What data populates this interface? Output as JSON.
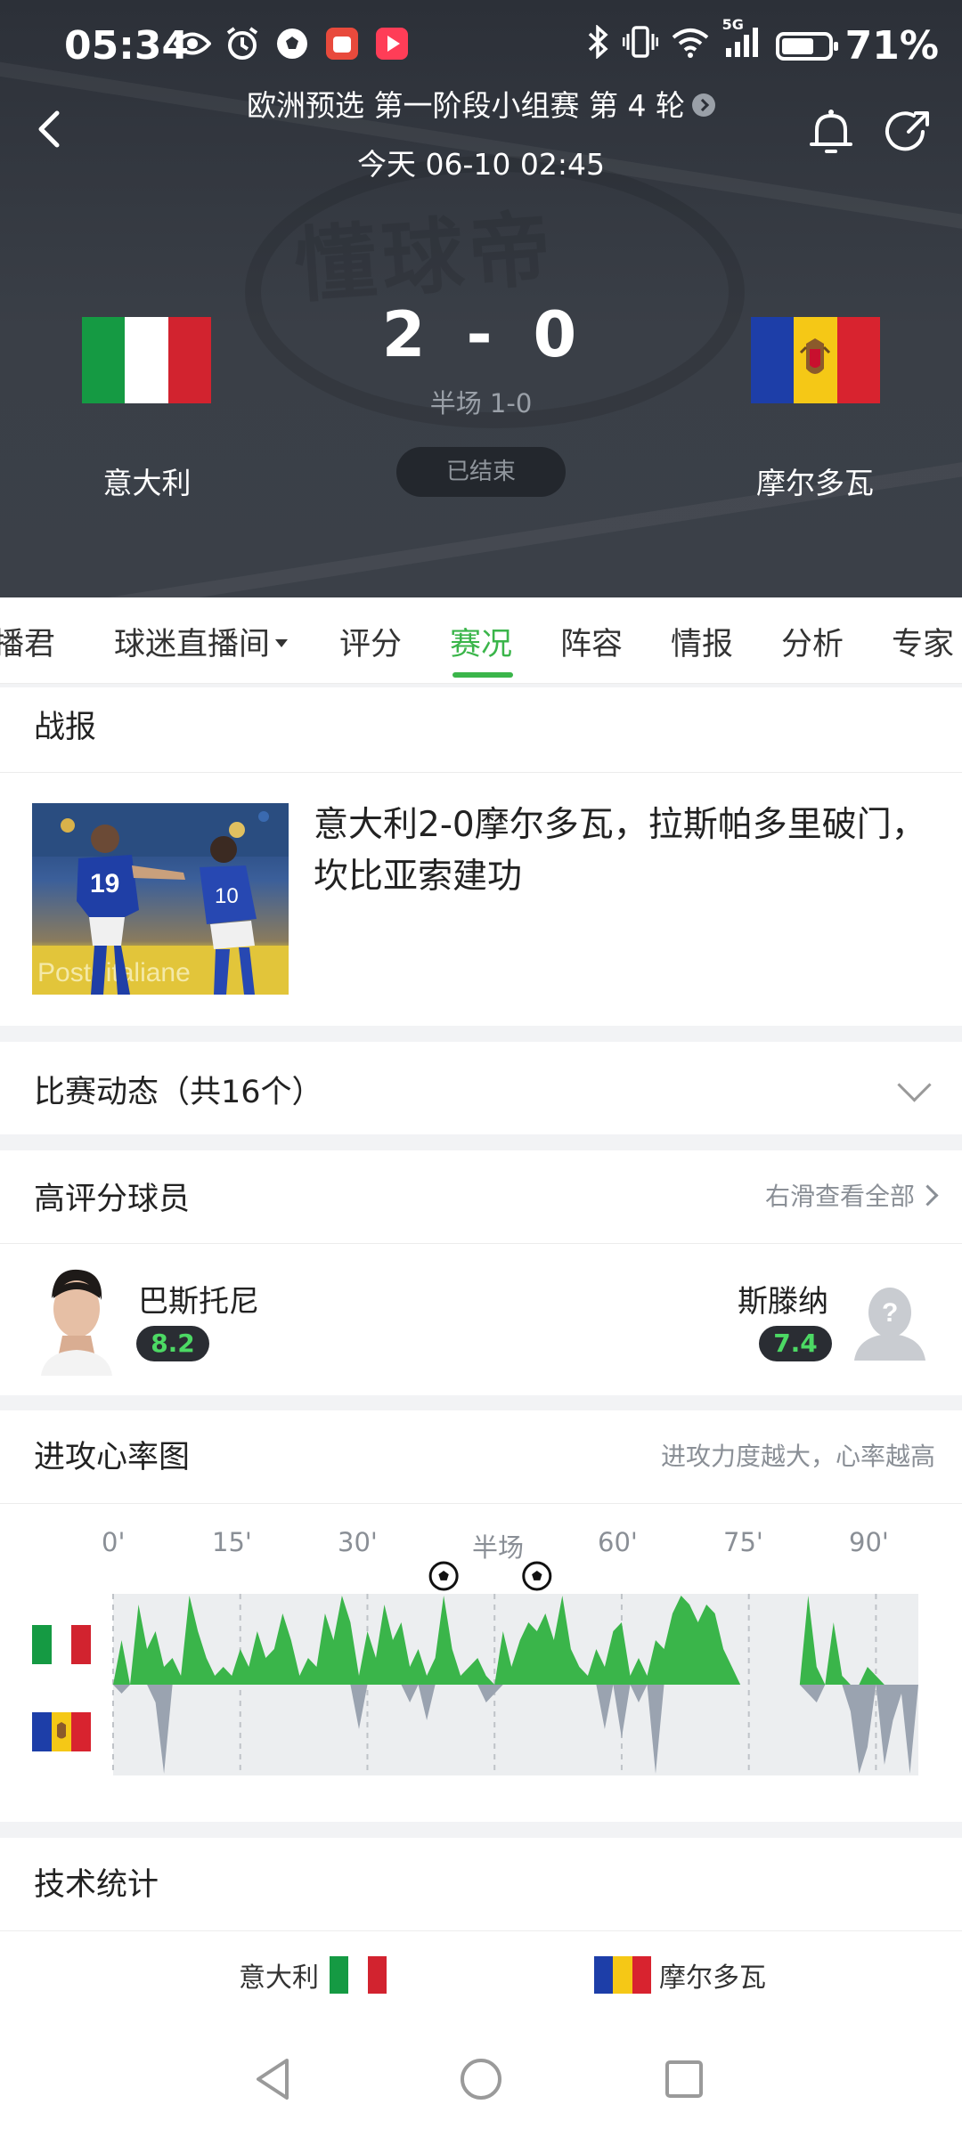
{
  "status_bar": {
    "time": "05:34",
    "battery_pct": "71%",
    "battery_level": 0.71,
    "network": "5G"
  },
  "header": {
    "competition": "欧洲预选 第一阶段小组赛 第 4 轮",
    "datetime": "今天 06-10 02:45",
    "watermark": "懂球帝",
    "home": {
      "name": "意大利",
      "score": "2",
      "flag_colors": [
        "#159a43",
        "#ffffff",
        "#d2232f"
      ]
    },
    "away": {
      "name": "摩尔多瓦",
      "score": "0",
      "flag_colors": [
        "#1d3ea8",
        "#f5c816",
        "#d8232f"
      ]
    },
    "score_sep": "-",
    "halftime": "半场 1-0",
    "match_status": "已结束"
  },
  "tabs": [
    {
      "label": "播君",
      "active": false
    },
    {
      "label": "球迷直播间",
      "active": false,
      "dropdown": true
    },
    {
      "label": "评分",
      "active": false
    },
    {
      "label": "赛况",
      "active": true
    },
    {
      "label": "阵容",
      "active": false
    },
    {
      "label": "情报",
      "active": false
    },
    {
      "label": "分析",
      "active": false
    },
    {
      "label": "专家",
      "active": false
    }
  ],
  "report": {
    "title": "战报",
    "headline": "意大利2-0摩尔多瓦，拉斯帕多里破门，坎比亚索建功"
  },
  "events": {
    "title": "比赛动态（共16个）"
  },
  "top_players": {
    "title": "高评分球员",
    "hint": "右滑查看全部",
    "home_player": {
      "name": "巴斯托尼",
      "rating": "8.2"
    },
    "away_player": {
      "name": "斯滕纳",
      "rating": "7.4"
    }
  },
  "heart_rate": {
    "title": "进攻心率图",
    "hint": "进攻力度越大，心率越高",
    "ticks": [
      "0'",
      "15'",
      "30'",
      "半场",
      "60'",
      "75'",
      "90'"
    ],
    "goal_minutes": [
      39,
      50
    ],
    "colors": {
      "home": "#3ab54a",
      "away": "#9aa3b0"
    }
  },
  "tech_stats": {
    "title": "技术统计",
    "home_name": "意大利",
    "away_name": "摩尔多瓦"
  },
  "chart_data": {
    "type": "area",
    "title": "进攻心率图",
    "xlabel": "",
    "ylabel": "",
    "x_ticks": [
      "0'",
      "15'",
      "30'",
      "半场",
      "60'",
      "75'",
      "90'"
    ],
    "xlim": [
      0,
      95
    ],
    "ylim": [
      -1,
      1
    ],
    "series": [
      {
        "name": "意大利",
        "values": [
          [
            0,
            0
          ],
          [
            1,
            0.5
          ],
          [
            2,
            0
          ],
          [
            3,
            0.9
          ],
          [
            4,
            0.4
          ],
          [
            5,
            0.6
          ],
          [
            6,
            0.2
          ],
          [
            7,
            0.3
          ],
          [
            8,
            0.1
          ],
          [
            9,
            1.0
          ],
          [
            10,
            0.6
          ],
          [
            11,
            0.3
          ],
          [
            12,
            0.1
          ],
          [
            13,
            0.2
          ],
          [
            14,
            0.1
          ],
          [
            15,
            0.4
          ],
          [
            16,
            0.2
          ],
          [
            17,
            0.6
          ],
          [
            18,
            0.3
          ],
          [
            19,
            0.4
          ],
          [
            20,
            0.8
          ],
          [
            21,
            0.5
          ],
          [
            22,
            0.1
          ],
          [
            23,
            0.3
          ],
          [
            24,
            0.2
          ],
          [
            25,
            0.8
          ],
          [
            26,
            0.5
          ],
          [
            27,
            1.0
          ],
          [
            28,
            0.7
          ],
          [
            29,
            0.1
          ],
          [
            30,
            0.6
          ],
          [
            31,
            0.3
          ],
          [
            32,
            0.9
          ],
          [
            33,
            0.5
          ],
          [
            34,
            0.7
          ],
          [
            35,
            0.2
          ],
          [
            36,
            0.4
          ],
          [
            37,
            0.1
          ],
          [
            38,
            0.3
          ],
          [
            39,
            1.0
          ],
          [
            40,
            0.4
          ],
          [
            41,
            0.1
          ],
          [
            42,
            0.2
          ],
          [
            43,
            0.3
          ],
          [
            44,
            0.1
          ],
          [
            45,
            0
          ],
          [
            46,
            0.6
          ],
          [
            47,
            0.2
          ],
          [
            48,
            0.5
          ],
          [
            49,
            0.7
          ],
          [
            50,
            0.6
          ],
          [
            51,
            0.8
          ],
          [
            52,
            0.5
          ],
          [
            53,
            1.0
          ],
          [
            54,
            0.4
          ],
          [
            55,
            0.2
          ],
          [
            56,
            0.1
          ],
          [
            57,
            0.4
          ],
          [
            58,
            0.2
          ],
          [
            59,
            0.6
          ],
          [
            60,
            0.7
          ],
          [
            61,
            0.1
          ],
          [
            62,
            0.3
          ],
          [
            63,
            0.1
          ],
          [
            64,
            0.5
          ],
          [
            65,
            0.4
          ],
          [
            66,
            0.8
          ],
          [
            67,
            1.0
          ],
          [
            68,
            0.9
          ],
          [
            69,
            0.7
          ],
          [
            70,
            0.9
          ],
          [
            71,
            0.8
          ],
          [
            72,
            0.4
          ],
          [
            73,
            0.2
          ],
          [
            74,
            0
          ],
          [
            75,
            0
          ],
          [
            76,
            0
          ],
          [
            77,
            0
          ],
          [
            78,
            0
          ],
          [
            79,
            0
          ],
          [
            80,
            0
          ],
          [
            81,
            0
          ],
          [
            82,
            1.0
          ],
          [
            83,
            0.2
          ],
          [
            84,
            0
          ],
          [
            85,
            0.7
          ],
          [
            86,
            0.1
          ],
          [
            87,
            0
          ],
          [
            88,
            0
          ],
          [
            89,
            0.2
          ],
          [
            90,
            0.1
          ],
          [
            91,
            0
          ],
          [
            92,
            0
          ],
          [
            93,
            0
          ],
          [
            94,
            0
          ],
          [
            95,
            0
          ]
        ]
      },
      {
        "name": "摩尔多瓦",
        "values": [
          [
            0,
            0
          ],
          [
            1,
            -0.1
          ],
          [
            2,
            0
          ],
          [
            3,
            0
          ],
          [
            4,
            0
          ],
          [
            5,
            -0.2
          ],
          [
            6,
            -1.0
          ],
          [
            7,
            0
          ],
          [
            8,
            0
          ],
          [
            9,
            0
          ],
          [
            10,
            0
          ],
          [
            11,
            0
          ],
          [
            12,
            0
          ],
          [
            13,
            0
          ],
          [
            14,
            0
          ],
          [
            15,
            0
          ],
          [
            16,
            0
          ],
          [
            17,
            0
          ],
          [
            18,
            0
          ],
          [
            19,
            0
          ],
          [
            20,
            0
          ],
          [
            21,
            0
          ],
          [
            22,
            0
          ],
          [
            23,
            0
          ],
          [
            24,
            0
          ],
          [
            25,
            0
          ],
          [
            26,
            0
          ],
          [
            27,
            0
          ],
          [
            28,
            0
          ],
          [
            29,
            -0.5
          ],
          [
            30,
            0
          ],
          [
            31,
            0
          ],
          [
            32,
            0
          ],
          [
            33,
            0
          ],
          [
            34,
            0
          ],
          [
            35,
            -0.2
          ],
          [
            36,
            0
          ],
          [
            37,
            -0.4
          ],
          [
            38,
            0
          ],
          [
            39,
            0
          ],
          [
            40,
            0
          ],
          [
            41,
            0
          ],
          [
            42,
            0
          ],
          [
            43,
            0
          ],
          [
            44,
            -0.2
          ],
          [
            45,
            -0.1
          ],
          [
            46,
            0
          ],
          [
            47,
            0
          ],
          [
            48,
            0
          ],
          [
            49,
            0
          ],
          [
            50,
            0
          ],
          [
            51,
            0
          ],
          [
            52,
            0
          ],
          [
            53,
            0
          ],
          [
            54,
            0
          ],
          [
            55,
            0
          ],
          [
            56,
            0
          ],
          [
            57,
            0
          ],
          [
            58,
            -0.5
          ],
          [
            59,
            0
          ],
          [
            60,
            -0.6
          ],
          [
            61,
            0
          ],
          [
            62,
            -0.2
          ],
          [
            63,
            0
          ],
          [
            64,
            -1.0
          ],
          [
            65,
            0
          ],
          [
            66,
            0
          ],
          [
            67,
            0
          ],
          [
            68,
            0
          ],
          [
            69,
            0
          ],
          [
            70,
            0
          ],
          [
            71,
            0
          ],
          [
            72,
            0
          ],
          [
            73,
            0
          ],
          [
            74,
            0
          ],
          [
            75,
            0
          ],
          [
            76,
            0
          ],
          [
            77,
            0
          ],
          [
            78,
            0
          ],
          [
            79,
            0
          ],
          [
            80,
            0
          ],
          [
            81,
            0
          ],
          [
            82,
            -0.1
          ],
          [
            83,
            -0.2
          ],
          [
            84,
            0
          ],
          [
            85,
            0
          ],
          [
            86,
            0
          ],
          [
            87,
            -0.3
          ],
          [
            88,
            -1.0
          ],
          [
            89,
            -0.7
          ],
          [
            90,
            0
          ],
          [
            91,
            -0.9
          ],
          [
            92,
            -0.4
          ],
          [
            93,
            -0.1
          ],
          [
            94,
            -1.0
          ],
          [
            95,
            0
          ]
        ]
      }
    ]
  }
}
